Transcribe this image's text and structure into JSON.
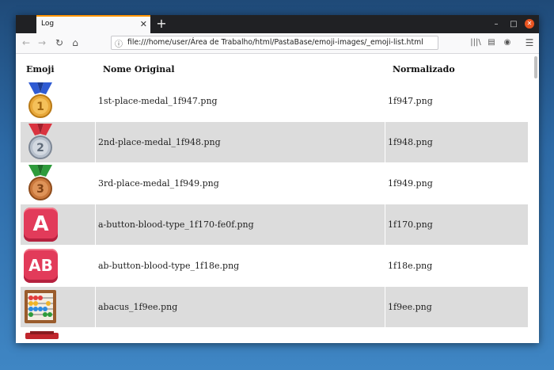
{
  "tab": {
    "title": "Log",
    "close_glyph": "✕"
  },
  "window_controls": {
    "minimize": "–",
    "maximize": "□",
    "close": "✕"
  },
  "toolbar": {
    "back_icon": "←",
    "forward_icon": "→",
    "reload_icon": "↻",
    "home_icon": "⌂",
    "url": "file:///home/user/Área de Trabalho/html/PastaBase/emoji-images/_emoji-list.html",
    "library_icon": "|||\\",
    "sidebar_icon": "▤",
    "account_icon": "◉",
    "menu_icon": "☰"
  },
  "table": {
    "headers": {
      "emoji": "Emoji",
      "original": "Nome Original",
      "normalized": "Normalizado"
    },
    "rows": [
      {
        "emoji": "1st-place-medal-icon",
        "original": "1st-place-medal_1f947.png",
        "normalized": "1f947.png",
        "glyph": "1"
      },
      {
        "emoji": "2nd-place-medal-icon",
        "original": "2nd-place-medal_1f948.png",
        "normalized": "1f948.png",
        "glyph": "2"
      },
      {
        "emoji": "3rd-place-medal-icon",
        "original": "3rd-place-medal_1f949.png",
        "normalized": "1f949.png",
        "glyph": "3"
      },
      {
        "emoji": "a-button-blood-type-icon",
        "original": "a-button-blood-type_1f170-fe0f.png",
        "normalized": "1f170.png",
        "glyph": "A"
      },
      {
        "emoji": "ab-button-blood-type-icon",
        "original": "ab-button-blood-type_1f18e.png",
        "normalized": "1f18e.png",
        "glyph": "AB"
      },
      {
        "emoji": "abacus-icon",
        "original": "abacus_1f9ee.png",
        "normalized": "1f9ee.png"
      }
    ]
  },
  "colors": {
    "tab_accent": "#ff9400",
    "row_alt": "#dcdcdc",
    "blood_type_red": "#e23b5a",
    "gold": "#e8a83a",
    "silver": "#b7c0cc",
    "bronze": "#c9773c",
    "ribbon_blue": "#2f5bd3",
    "ribbon_red": "#d9333f",
    "ribbon_green": "#2e9b3b",
    "close_button": "#e95420"
  }
}
